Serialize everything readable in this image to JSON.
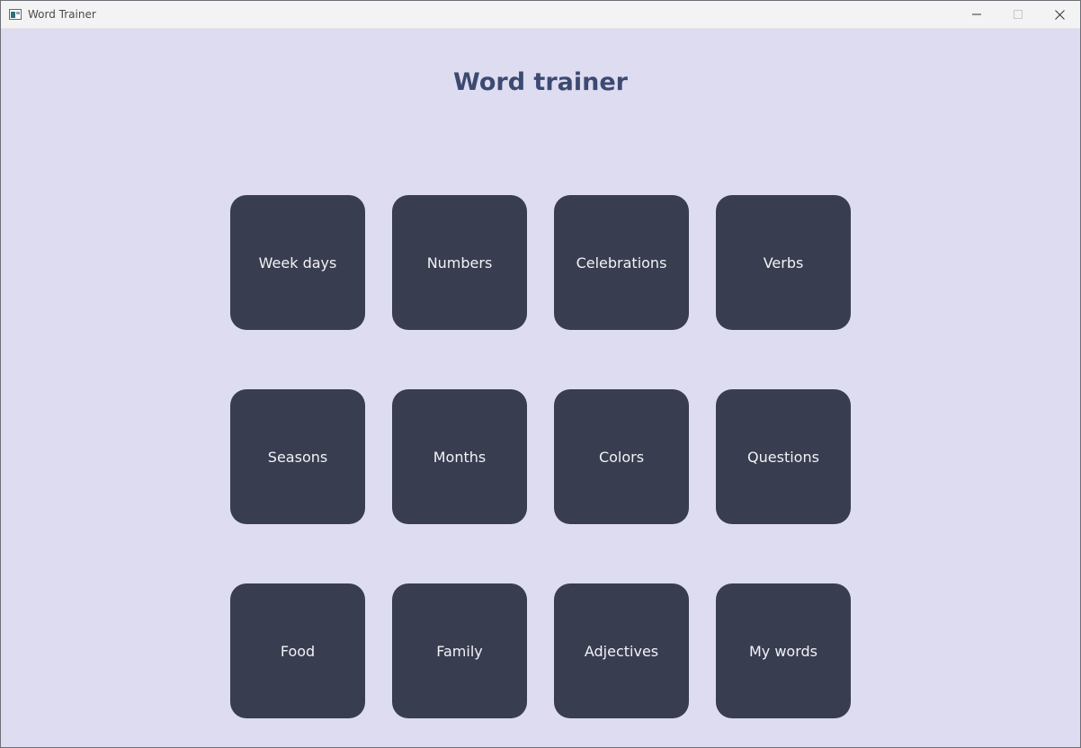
{
  "window": {
    "title": "Word Trainer",
    "controls": {
      "minimize_icon": "minimize-icon",
      "maximize_icon": "maximize-icon",
      "close_icon": "close-icon"
    }
  },
  "main": {
    "heading": "Word trainer",
    "categories": [
      {
        "label": "Week days"
      },
      {
        "label": "Numbers"
      },
      {
        "label": "Celebrations"
      },
      {
        "label": "Verbs"
      },
      {
        "label": "Seasons"
      },
      {
        "label": "Months"
      },
      {
        "label": "Colors"
      },
      {
        "label": "Questions"
      },
      {
        "label": "Food"
      },
      {
        "label": "Family"
      },
      {
        "label": "Adjectives"
      },
      {
        "label": "My words"
      }
    ]
  },
  "colors": {
    "background": "#dedcf0",
    "tile": "#383d4f",
    "tile_text": "#f2f2f7",
    "heading": "#3c4a72"
  }
}
